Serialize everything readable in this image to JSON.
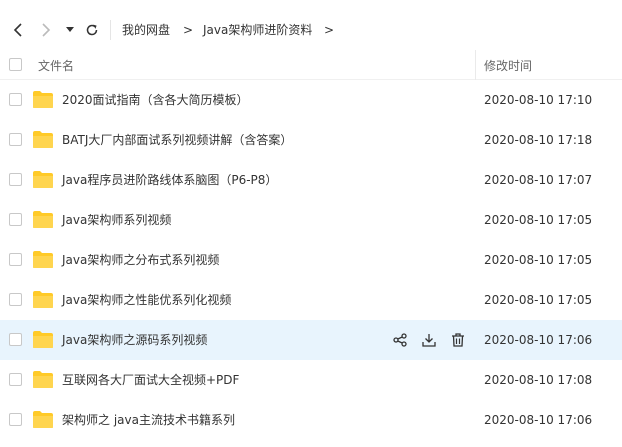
{
  "breadcrumb": {
    "root": "我的网盘",
    "separator": ">",
    "current": "Java架构师进阶资料"
  },
  "table": {
    "col_name": "文件名",
    "col_modified": "修改时间"
  },
  "colors": {
    "folder": "#ffca28",
    "hover_row": "#e8f4fd"
  },
  "files": [
    {
      "name": "2020面试指南（含各大简历模板）",
      "modified": "2020-08-10 17:10",
      "icon": "folder-icon"
    },
    {
      "name": "BATJ大厂内部面试系列视频讲解（含答案）",
      "modified": "2020-08-10 17:18",
      "icon": "folder-icon"
    },
    {
      "name": "Java程序员进阶路线体系脑图（P6-P8）",
      "modified": "2020-08-10 17:07",
      "icon": "folder-icon"
    },
    {
      "name": "Java架构师系列视频",
      "modified": "2020-08-10 17:05",
      "icon": "folder-icon"
    },
    {
      "name": "Java架构师之分布式系列视频",
      "modified": "2020-08-10 17:05",
      "icon": "folder-icon"
    },
    {
      "name": "Java架构师之性能优系列化视频",
      "modified": "2020-08-10 17:05",
      "icon": "folder-icon"
    },
    {
      "name": "Java架构师之源码系列视频",
      "modified": "2020-08-10 17:06",
      "icon": "folder-icon",
      "hovered": true
    },
    {
      "name": "互联网各大厂面试大全视频+PDF",
      "modified": "2020-08-10 17:08",
      "icon": "folder-icon"
    },
    {
      "name": "架构师之 java主流技术书籍系列",
      "modified": "2020-08-10 17:06",
      "icon": "folder-icon"
    }
  ]
}
